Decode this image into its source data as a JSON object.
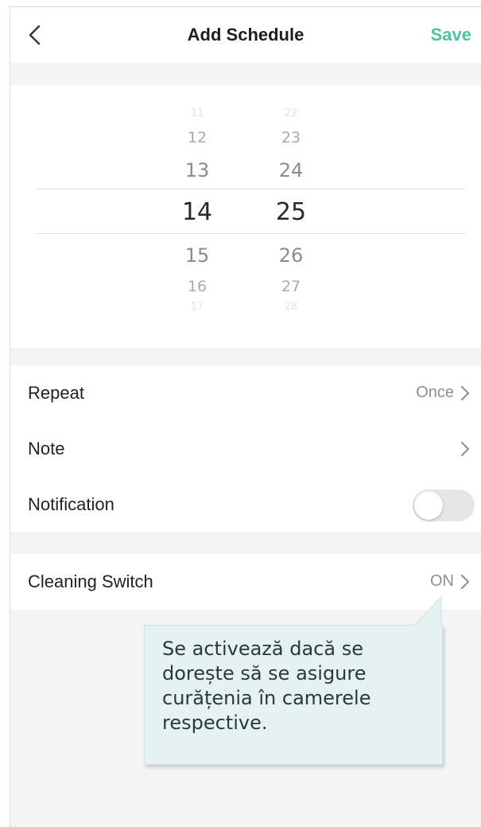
{
  "header": {
    "back_icon": "chevron-left-icon",
    "title": "Add Schedule",
    "save_label": "Save",
    "accent_color": "#4fc3a1"
  },
  "time_picker": {
    "hours": [
      "11",
      "12",
      "13",
      "14",
      "15",
      "16",
      "17"
    ],
    "minutes": [
      "22",
      "23",
      "24",
      "25",
      "26",
      "27",
      "28"
    ],
    "selected_hour": "14",
    "selected_minute": "25"
  },
  "settings": {
    "repeat": {
      "label": "Repeat",
      "value": "Once",
      "icon": "chevron-right-icon"
    },
    "note": {
      "label": "Note",
      "icon": "chevron-right-icon"
    },
    "notification": {
      "label": "Notification",
      "toggle_on": false
    },
    "cleaning_switch": {
      "label": "Cleaning Switch",
      "value": "ON",
      "icon": "chevron-right-icon"
    }
  },
  "callout": {
    "text": "Se activează dacă se dorește să se asigure curățenia în camerele respective.",
    "background": "#e4f2f1"
  }
}
